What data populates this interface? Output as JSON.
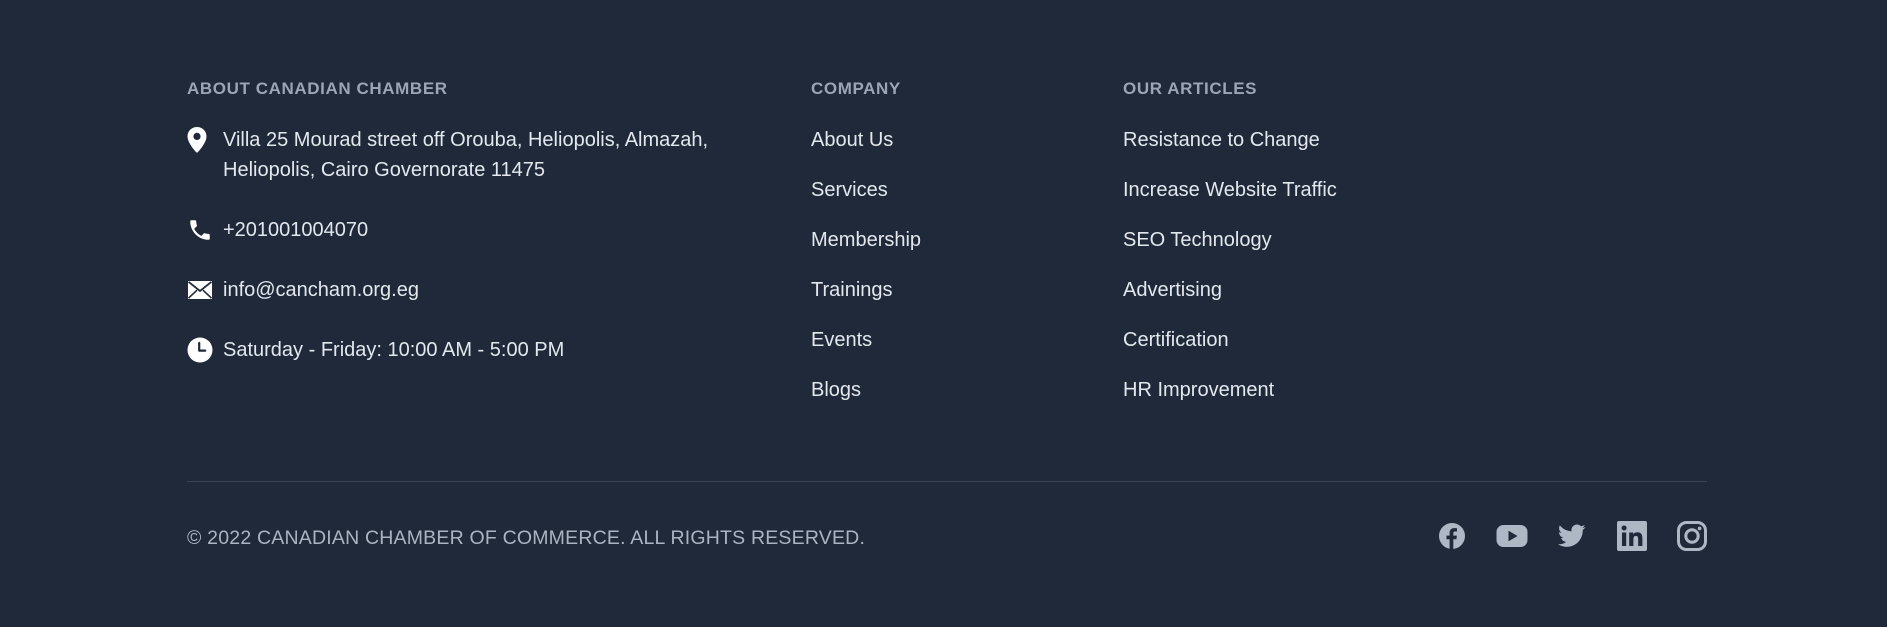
{
  "about": {
    "heading": "ABOUT CANADIAN CHAMBER",
    "address_line1": "Villa 25 Mourad street off Orouba, Heliopolis, Almazah,",
    "address_line2": "Heliopolis, Cairo Governorate 11475",
    "phone": "+201001004070",
    "email": "info@cancham.org.eg",
    "hours": "Saturday - Friday: 10:00 AM - 5:00 PM",
    "icons": [
      "location-pin-icon",
      "phone-icon",
      "envelope-icon",
      "clock-icon"
    ]
  },
  "company": {
    "heading": "COMPANY",
    "links": [
      "About Us",
      "Services",
      "Membership",
      "Trainings",
      "Events",
      "Blogs"
    ]
  },
  "articles": {
    "heading": "OUR ARTICLES",
    "links": [
      "Resistance to Change",
      "Increase Website Traffic",
      "SEO Technology",
      "Advertising",
      "Certification",
      "HR Improvement"
    ]
  },
  "bottom": {
    "copyright": "© 2022 CANADIAN CHAMBER OF COMMERCE. ALL RIGHTS RESERVED.",
    "social": [
      "facebook-icon",
      "youtube-icon",
      "twitter-icon",
      "linkedin-icon",
      "instagram-icon"
    ]
  },
  "colors": {
    "background": "#1f2939",
    "heading": "#9aa6b6",
    "text": "#e3e7ee",
    "muted": "#aab4c2",
    "divider": "#394556",
    "social_icon": "#aeb7c4"
  }
}
